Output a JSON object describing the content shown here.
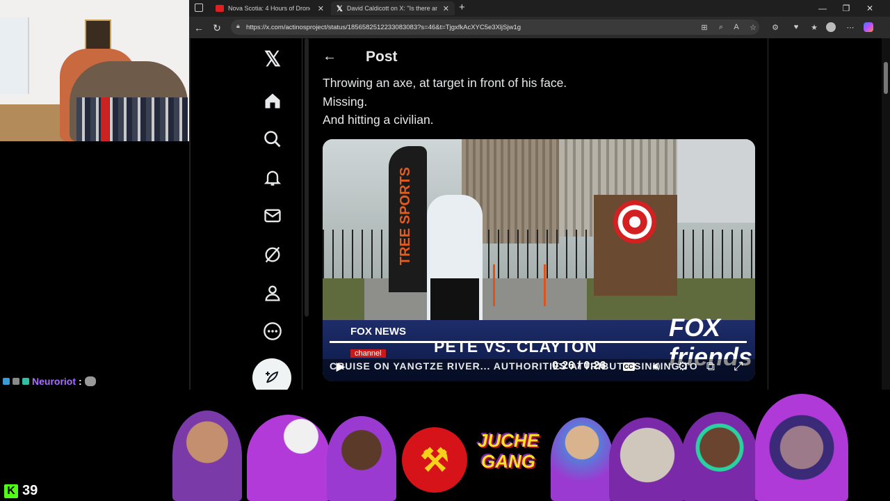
{
  "browser": {
    "tabs": [
      {
        "title": "Nova Scotia: 4 Hours of Drone",
        "active": false
      },
      {
        "title": "David Caldicott on X: \"Is there an",
        "active": true
      }
    ],
    "new_tab_label": "+",
    "url": "https://x.com/actinosproject/status/1856582512233083083?s=46&t=TjgxfkAcXYC5e3XljSjw1g"
  },
  "x": {
    "header_title": "Post",
    "tweet_lines": [
      "Throwing an axe, at target in front of his face.",
      "Missing.",
      "And hitting a civilian."
    ],
    "nav_icons": [
      "x-logo-icon",
      "home-icon",
      "search-icon",
      "notifications-icon",
      "messages-icon",
      "grok-icon",
      "profile-icon",
      "more-icon"
    ],
    "video": {
      "banner_text": "TREE SPORTS",
      "news_bug": "FOX NEWS",
      "news_channel": "channel",
      "headline": "PETE VS. CLAYTON",
      "show_logo": "FOX friends",
      "ticker": "CRUISE ON YANGTZE RIVER... AUTHORITIES ATTRIBUTE SINKING TO",
      "time": "0:26 / 0:26",
      "cc": "CC"
    }
  },
  "chat": {
    "username": "Neuroriot",
    "colon": ":"
  },
  "stream": {
    "viewer_count": "39",
    "platform_logo": "K",
    "emote_text_1": "JUCHE",
    "emote_text_2": "GANG"
  },
  "colors": {
    "x_bg": "#000000",
    "chat_name": "#a970ff",
    "kick_green": "#53fc18"
  }
}
